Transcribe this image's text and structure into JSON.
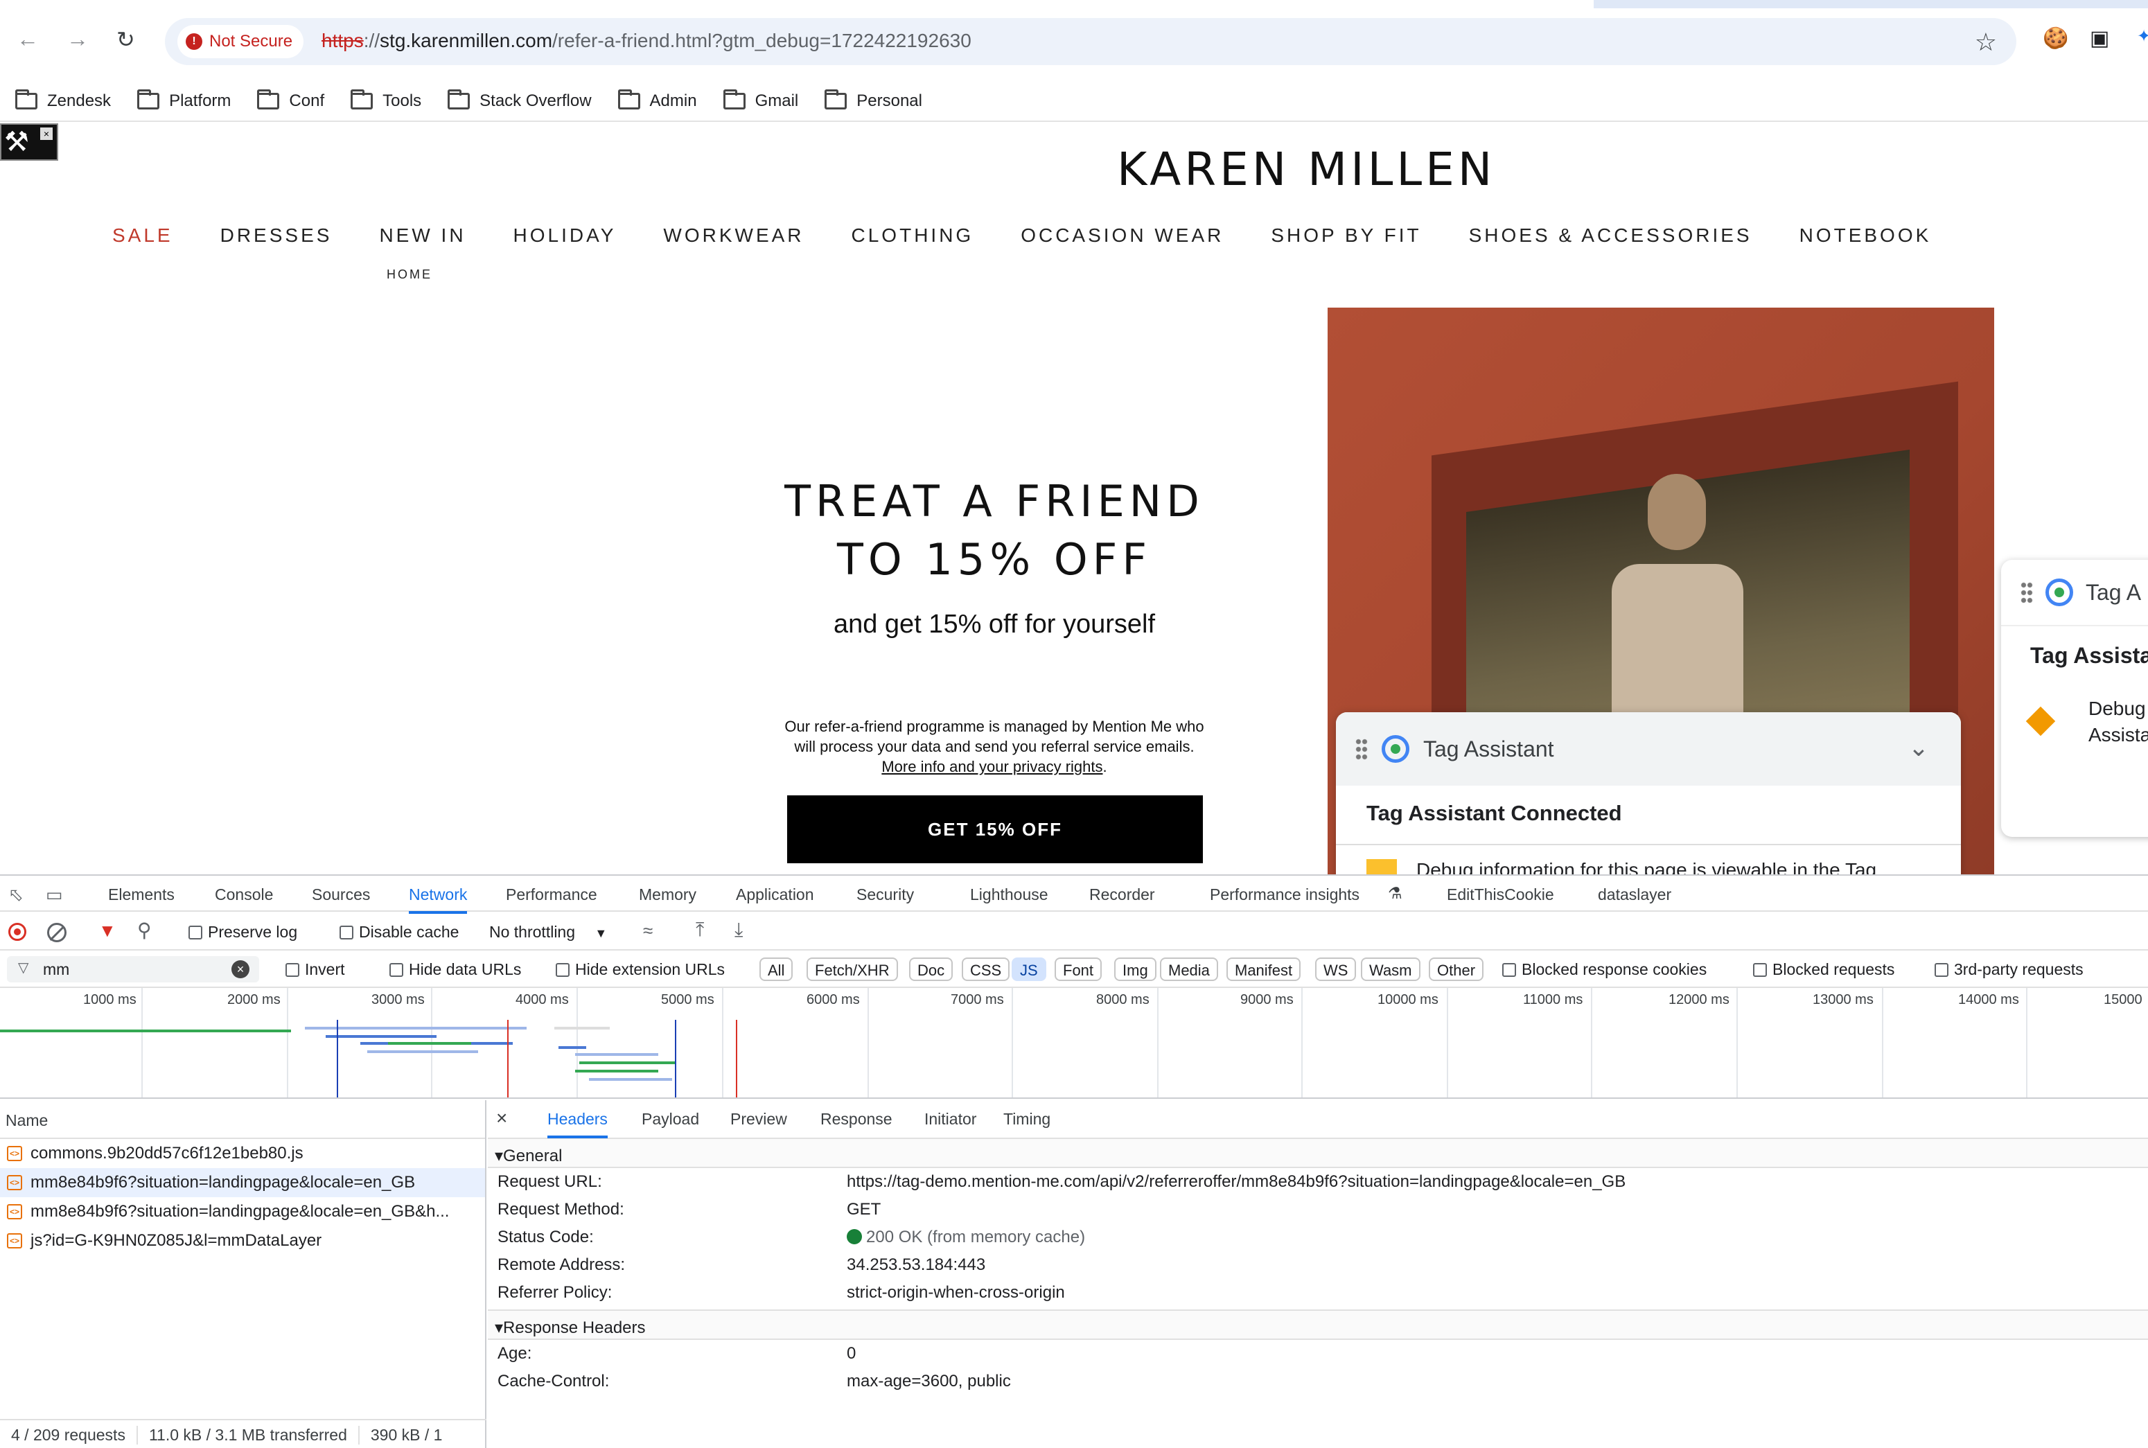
{
  "browser": {
    "not_secure_label": "Not Secure",
    "url_scheme": "https",
    "url_sep": "://",
    "url_host": "stg.karenmillen.com",
    "url_path": "/refer-a-friend.html?gtm_debug=1722422192630",
    "bookmarks": [
      "Zendesk",
      "Platform",
      "Conf",
      "Tools",
      "Stack Overflow",
      "Admin",
      "Gmail",
      "Personal"
    ]
  },
  "site": {
    "logo": "KAREN MILLEN",
    "nav": [
      "SALE",
      "DRESSES",
      "NEW IN",
      "HOLIDAY",
      "WORKWEAR",
      "CLOTHING",
      "OCCASION WEAR",
      "SHOP BY FIT",
      "SHOES & ACCESSORIES",
      "NOTEBOOK"
    ],
    "breadcrumb": "HOME",
    "hero_title_line1": "TREAT A FRIEND",
    "hero_title_line2": "TO 15% OFF",
    "hero_subtitle": "and get 15% off for yourself",
    "hero_small_text": "Our refer-a-friend programme is managed by Mention Me who will process your data and send you referral service emails.",
    "hero_small_link": "More info and your privacy rights",
    "hero_small_end": ".",
    "cta_label": "GET 15% OFF",
    "sale_color": "#c0392b"
  },
  "tag_assistant_back": {
    "title": "Tag A",
    "heading": "Tag Assista",
    "line1": "Debug",
    "line2": "Assista"
  },
  "tag_assistant_front": {
    "title": "Tag Assistant",
    "heading": "Tag Assistant Connected",
    "message": "Debug information for this page is viewable in the Tag"
  },
  "devtools": {
    "tabs": [
      "Elements",
      "Console",
      "Sources",
      "Network",
      "Performance",
      "Memory",
      "Application",
      "Security",
      "Lighthouse",
      "Recorder",
      "Performance insights",
      "EditThisCookie",
      "dataslayer"
    ],
    "active_tab": "Network",
    "toolbar": {
      "preserve_log": "Preserve log",
      "disable_cache": "Disable cache",
      "throttling": "No throttling"
    },
    "filter": {
      "value": "mm",
      "invert": "Invert",
      "hide_data_urls": "Hide data URLs",
      "hide_extension_urls": "Hide extension URLs",
      "types": [
        "All",
        "Fetch/XHR",
        "Doc",
        "CSS",
        "JS",
        "Font",
        "Img",
        "Media",
        "Manifest",
        "WS",
        "Wasm",
        "Other"
      ],
      "active_type": "JS",
      "blocked_cookies": "Blocked response cookies",
      "blocked_requests": "Blocked requests",
      "third_party": "3rd-party requests"
    },
    "timeline_labels": [
      "1000 ms",
      "2000 ms",
      "3000 ms",
      "4000 ms",
      "5000 ms",
      "6000 ms",
      "7000 ms",
      "8000 ms",
      "9000 ms",
      "10000 ms",
      "11000 ms",
      "12000 ms",
      "13000 ms",
      "14000 ms",
      "15000"
    ],
    "name_header": "Name",
    "requests": [
      "commons.9b20dd57c6f12e1beb80.js",
      "mm8e84b9f6?situation=landingpage&locale=en_GB",
      "mm8e84b9f6?situation=landingpage&locale=en_GB&h...",
      "js?id=G-K9HN0Z085J&l=mmDataLayer"
    ],
    "status": {
      "requests": "4 / 209 requests",
      "transferred": "11.0 kB / 3.1 MB transferred",
      "resources": "390 kB / 1"
    },
    "detail_tabs": [
      "Headers",
      "Payload",
      "Preview",
      "Response",
      "Initiator",
      "Timing"
    ],
    "active_detail_tab": "Headers",
    "general_label": "General",
    "general": [
      {
        "k": "Request URL:",
        "v": "https://tag-demo.mention-me.com/api/v2/referreroffer/mm8e84b9f6?situation=landingpage&locale=en_GB"
      },
      {
        "k": "Request Method:",
        "v": "GET"
      },
      {
        "k": "Status Code:",
        "v": "200 OK (from memory cache)"
      },
      {
        "k": "Remote Address:",
        "v": "34.253.53.184:443"
      },
      {
        "k": "Referrer Policy:",
        "v": "strict-origin-when-cross-origin"
      }
    ],
    "response_headers_label": "Response Headers",
    "response_headers": [
      {
        "k": "Age:",
        "v": "0"
      },
      {
        "k": "Cache-Control:",
        "v": "max-age=3600, public"
      }
    ]
  }
}
